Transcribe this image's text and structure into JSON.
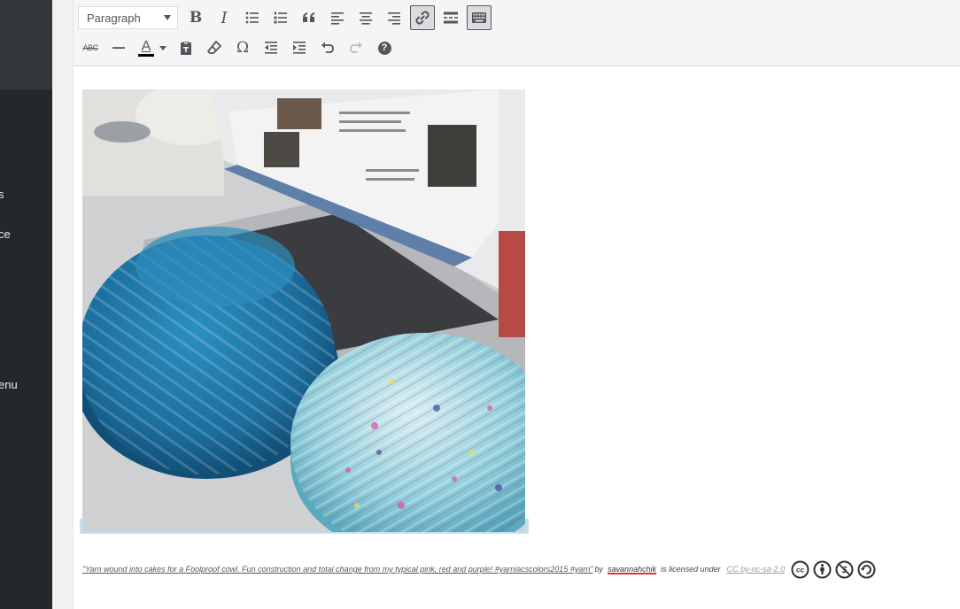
{
  "sidebar": {
    "items": [
      {
        "label": "s"
      },
      {
        "label": "ce"
      },
      {
        "label": "enu"
      }
    ]
  },
  "toolbar": {
    "format_select": "Paragraph",
    "row1": [
      {
        "name": "bold",
        "glyph": "B"
      },
      {
        "name": "italic",
        "glyph": "I"
      },
      {
        "name": "bullet-list",
        "icon": "bullet-list-icon"
      },
      {
        "name": "numbered-list",
        "icon": "numbered-list-icon"
      },
      {
        "name": "blockquote",
        "icon": "quote-icon"
      },
      {
        "name": "align-left",
        "icon": "align-left-icon"
      },
      {
        "name": "align-center",
        "icon": "align-center-icon"
      },
      {
        "name": "align-right",
        "icon": "align-right-icon"
      },
      {
        "name": "insert-link",
        "icon": "link-icon",
        "active": true
      },
      {
        "name": "read-more",
        "icon": "read-more-icon"
      },
      {
        "name": "toolbar-toggle",
        "icon": "keyboard-icon",
        "active": true
      }
    ],
    "row2": [
      {
        "name": "strikethrough",
        "glyph": "ABC"
      },
      {
        "name": "horizontal-line",
        "icon": "horizontal-line-icon"
      },
      {
        "name": "text-color",
        "glyph": "A",
        "color": "#000000"
      },
      {
        "name": "paste-as-text",
        "icon": "clipboard-icon"
      },
      {
        "name": "clear-formatting",
        "icon": "eraser-icon"
      },
      {
        "name": "special-character",
        "glyph": "Ω"
      },
      {
        "name": "outdent",
        "icon": "outdent-icon"
      },
      {
        "name": "indent",
        "icon": "indent-icon"
      },
      {
        "name": "undo",
        "icon": "undo-icon"
      },
      {
        "name": "redo",
        "icon": "redo-icon",
        "disabled": true
      },
      {
        "name": "help",
        "glyph": "?"
      }
    ]
  },
  "content": {
    "image": {
      "subject": "two yarn cakes in front of a laptop",
      "icon": "photo"
    },
    "attribution": {
      "quote": "\"Yarn wound into cakes for a Foolproof cowl. Fun construction and total change from my typical pink, red and purple! #yarniacscolors2015 #yarn\"",
      "by": "by",
      "author": "savannahchik",
      "licensed": "is licensed under",
      "license": "CC by-nc-sa-2.0",
      "license_icons": [
        "cc-icon",
        "attribution-icon",
        "noncommercial-icon",
        "share-alike-icon"
      ]
    }
  },
  "colors": {
    "sidebar_bg": "#23282d",
    "toolbar_bg": "#f5f5f5",
    "icon": "#50575e",
    "selection": "#bfe0f7",
    "spell_underline": "#d63638"
  }
}
